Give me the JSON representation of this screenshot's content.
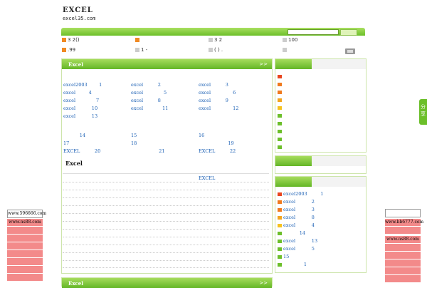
{
  "logo": {
    "line1": "EXCEL",
    "line2": "excel35.com"
  },
  "quick_links": [
    {
      "text": "3 2()",
      "box": "orange"
    },
    {
      "text": "",
      "box": "orange"
    },
    {
      "text": "3 2",
      "box": "gray"
    },
    {
      "text": "100",
      "box": "gray"
    },
    {
      "text": ".99",
      "box": "orange"
    },
    {
      "text": "1 -",
      "box": "gray"
    },
    {
      "text": "( ) .",
      "box": "gray"
    },
    {
      "text": "",
      "box": "gray"
    }
  ],
  "main_panel": {
    "title": "Excel",
    "more": ">>"
  },
  "grid_rows": [
    [
      "excel2003        1",
      "excel          2",
      "excel          3"
    ],
    [
      "excel         4",
      "excel              5",
      "excel               6"
    ],
    [
      "excel              7",
      "excel          8",
      "excel          9"
    ],
    [
      "excel           10",
      "excel             11",
      "excel               12"
    ],
    [
      "excel           13",
      "",
      ""
    ]
  ],
  "grid_rows2": [
    [
      "           14",
      "15",
      "16"
    ],
    [
      "17",
      "18",
      "                    19"
    ],
    [
      "EXCEL          20",
      "                   21",
      "EXCEL          22"
    ]
  ],
  "sub_section": {
    "title": "Excel",
    "link": "EXCEL"
  },
  "bottom_panel": {
    "title": "Excel",
    "more": ">>"
  },
  "right_list_2": [
    "excel2003         1",
    "excel           2",
    "excel           3",
    "excel           8",
    "excel           4",
    "           14",
    "excel           13",
    "excel           5",
    "15",
    "              1"
  ],
  "share_tab": {
    "text": "分享"
  },
  "left_ads": {
    "top": "www.596666.com",
    "first": "www.ns88.com"
  },
  "right_ads": {
    "first": "www.bb6777.com",
    "second": "www.ns88.com"
  }
}
